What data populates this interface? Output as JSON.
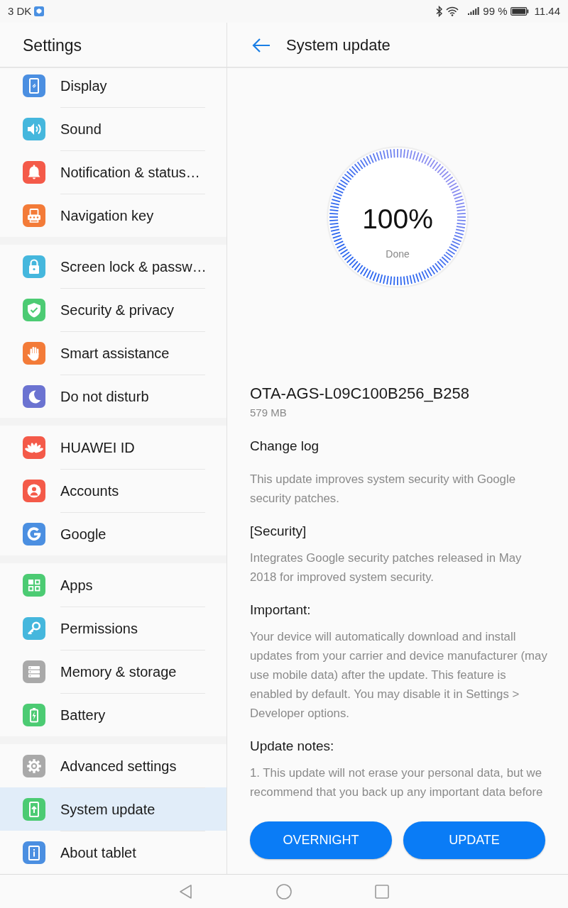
{
  "status_bar": {
    "carrier": "3 DK",
    "battery": "99 %",
    "time": "11.44"
  },
  "sidebar": {
    "title": "Settings",
    "groups": [
      {
        "items": [
          {
            "label": "Display",
            "selected": false
          },
          {
            "label": "Sound",
            "selected": false
          },
          {
            "label": "Notification & status…",
            "selected": false
          },
          {
            "label": "Navigation key",
            "selected": false
          }
        ]
      },
      {
        "items": [
          {
            "label": "Screen lock & passw…",
            "selected": false
          },
          {
            "label": "Security & privacy",
            "selected": false
          },
          {
            "label": "Smart assistance",
            "selected": false
          },
          {
            "label": "Do not disturb",
            "selected": false
          }
        ]
      },
      {
        "items": [
          {
            "label": "HUAWEI ID",
            "selected": false
          },
          {
            "label": "Accounts",
            "selected": false
          },
          {
            "label": "Google",
            "selected": false
          }
        ]
      },
      {
        "items": [
          {
            "label": "Apps",
            "selected": false
          },
          {
            "label": "Permissions",
            "selected": false
          },
          {
            "label": "Memory & storage",
            "selected": false
          },
          {
            "label": "Battery",
            "selected": false
          }
        ]
      },
      {
        "items": [
          {
            "label": "Advanced settings",
            "selected": false
          },
          {
            "label": "System update",
            "selected": true
          },
          {
            "label": "About tablet",
            "selected": false
          }
        ]
      }
    ]
  },
  "detail": {
    "title": "System update",
    "progress": {
      "level": 1,
      "reading": "100%",
      "status": "Done"
    },
    "package": {
      "name": "OTA-AGS-L09C100B256_B258",
      "size": "579 MB"
    },
    "sections": [
      {
        "heading": "Change log",
        "text": "This update improves system security with Google security patches."
      },
      {
        "heading": "[Security]",
        "text": "Integrates Google security patches released in May 2018 for improved system security."
      },
      {
        "heading": "Important:",
        "text": "Your device will automatically download and install updates from your carrier and device manufacturer (may use mobile data) after the update. This feature is enabled by default. You may disable it in Settings > Developer options."
      },
      {
        "heading": "Update notes:",
        "text": "1. This update will not erase your personal data, but we recommend that you back up any important data before"
      }
    ],
    "buttons": [
      "OVERNIGHT",
      "UPDATE"
    ]
  }
}
